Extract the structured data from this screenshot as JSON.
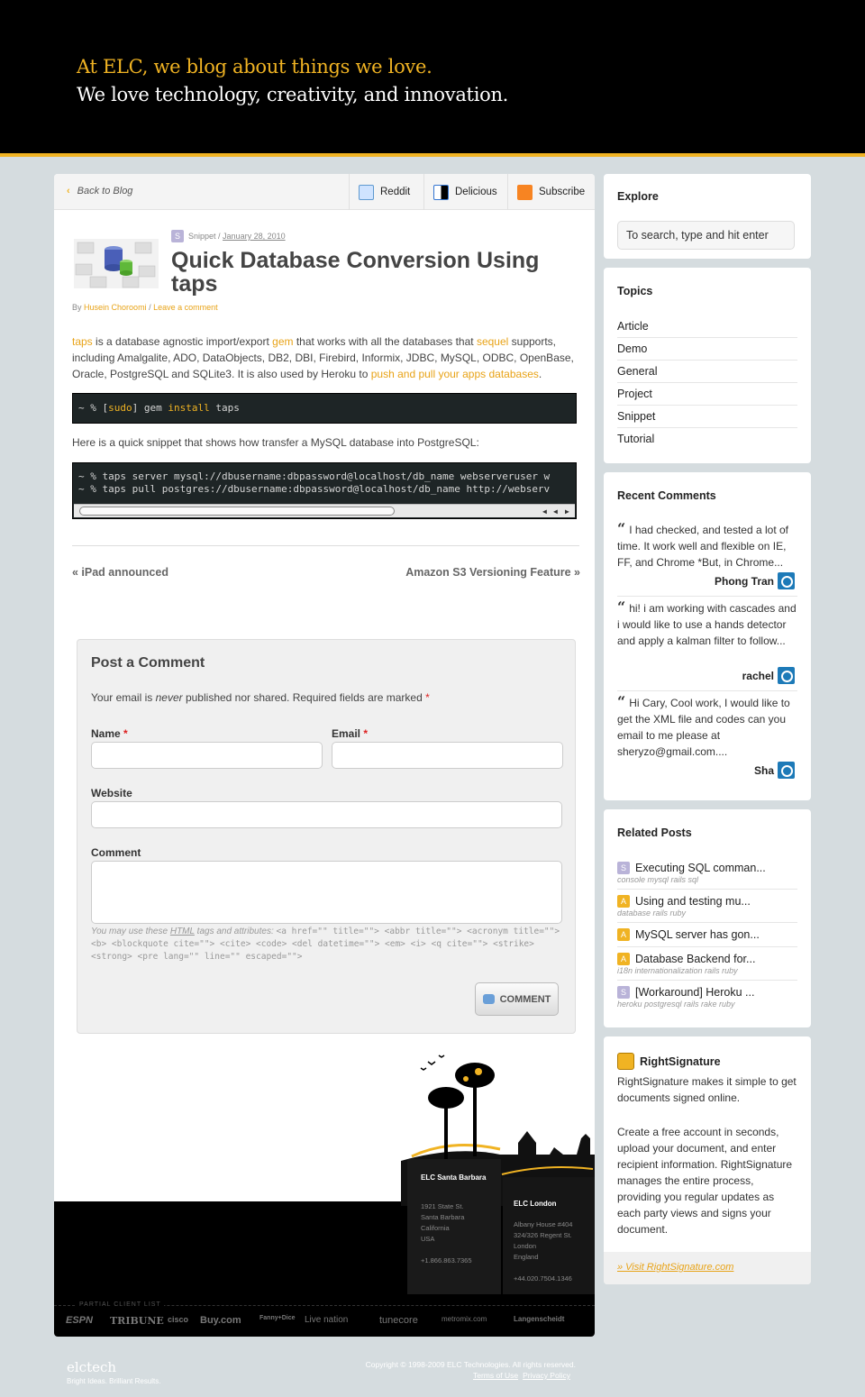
{
  "header": {
    "tagline1": "At ELC, we blog about things we love.",
    "tagline2": "We love technology, creativity, and innovation."
  },
  "topbar": {
    "back_label": "Back to Blog",
    "reddit_label": "Reddit",
    "delicious_label": "Delicious",
    "subscribe_label": "Subscribe"
  },
  "post": {
    "category": "Snippet",
    "date": "January 28, 2010",
    "title": "Quick Database Conversion Using taps",
    "by_prefix": "By",
    "author": "Husein Choroomi",
    "separator": "/",
    "leave_comment": "Leave a comment",
    "para1": {
      "taps": "taps",
      "t1": " is a database agnostic import/export ",
      "gem": "gem",
      "t2": " that works with all the databases that ",
      "sequel": "sequel",
      "t3": " supports, including Amalgalite, ADO, DataObjects, DB2, DBI, Firebird, Informix, JDBC, MySQL, ODBC, OpenBase, Oracle, PostgreSQL and SQLite3. It is also used by Heroku to ",
      "push_link": "push and pull your apps databases",
      "t4": "."
    },
    "code1": {
      "prompt": "~ % ",
      "bracket_open": "[",
      "sudo": "sudo",
      "bracket_close": "]",
      "gem": " gem ",
      "install": "install",
      "rest": " taps"
    },
    "para2": "Here is a quick snippet that shows how transfer a MySQL database into PostgreSQL:",
    "code2": [
      "~ % taps server mysql://dbusername:dbpassword@localhost/db_name webserveruser w",
      "~ % taps pull postgres://dbusername:dbpassword@localhost/db_name http://webserv"
    ],
    "prev": "« iPad announced",
    "next": "Amazon S3 Versioning Feature »"
  },
  "comment_form": {
    "title": "Post a Comment",
    "note_before": "Your email is ",
    "note_never": "never",
    "note_after": " published nor shared. Required fields are marked ",
    "asterisk": "*",
    "name_label": "Name",
    "email_label": "Email",
    "website_label": "Website",
    "comment_label": "Comment",
    "allowed_prefix": "You may use these ",
    "allowed_html": "HTML",
    "allowed_suffix": " tags and attributes: ",
    "allowed_tags": "<a href=\"\" title=\"\"> <abbr title=\"\"> <acronym title=\"\"> <b> <blockquote cite=\"\"> <cite> <code> <del datetime=\"\"> <em> <i> <q cite=\"\"> <strike> <strong> <pre lang=\"\" line=\"\" escaped=\"\">",
    "submit_label": "COMMENT"
  },
  "footer": {
    "sb_city": "ELC Santa Barbara",
    "sb_addr": [
      "1921 State St.",
      "Santa Barbara",
      "California",
      "USA"
    ],
    "sb_phone": "+1.866.863.7365",
    "ld_city": "ELC London",
    "ld_addr": [
      "Albany House #404",
      "324/326 Regent St.",
      "London",
      "England"
    ],
    "ld_phone": "+44.020.7504.1346",
    "client_list_label": "PARTIAL CLIENT LIST",
    "clients": [
      "ESPN",
      "TRIBUNE",
      "cisco",
      "Buy.com",
      "Fanny+Dice",
      "Live nation",
      "tunecore",
      "metromix.com",
      "Langenscheidt"
    ],
    "brand": "elctech",
    "brand_sub": "Bright Ideas. Brilliant Results.",
    "copyright": "Copyright © 1998-2009 ELC Technologies. All rights reserved.",
    "terms": "Terms of Use",
    "privacy": "Privacy Policy"
  },
  "sidebar": {
    "explore_title": "Explore",
    "search_placeholder": "To search, type and hit enter",
    "topics_title": "Topics",
    "topics": [
      "Article",
      "Demo",
      "General",
      "Project",
      "Snippet",
      "Tutorial"
    ],
    "recent_title": "Recent Comments",
    "comments": [
      {
        "text": "I had checked, and tested a lot of time. It work well and flexible on IE, FF, and Chrome *But, in Chrome...",
        "author": "Phong Tran"
      },
      {
        "text": "hi! i am working with cascades and i would like to use a hands detector and apply a kalman filter to follow...",
        "author": "rachel"
      },
      {
        "text": "Hi Cary, Cool work, I would like to get the XML file and codes can you email to me please at sheryzo@gmail.com....",
        "author": "Sha"
      }
    ],
    "related_title": "Related Posts",
    "related": [
      {
        "badge": "S",
        "title": "Executing SQL comman...",
        "tags": "console mysql rails sql"
      },
      {
        "badge": "A",
        "title": "Using and testing mu...",
        "tags": "database rails ruby"
      },
      {
        "badge": "A",
        "title": "MySQL server has gon...",
        "tags": ""
      },
      {
        "badge": "A",
        "title": "Database Backend for...",
        "tags": "i18n internationalization rails ruby"
      },
      {
        "badge": "S",
        "title": "[Workaround] Heroku ...",
        "tags": "heroku postgresql rails rake ruby"
      }
    ],
    "rs_title": "RightSignature",
    "rs_text1": "RightSignature makes it simple to get documents signed online.",
    "rs_text2": "Create a free account in seconds, upload your document, and enter recipient information. RightSignature manages the entire process, providing you regular updates as each party views and signs your document.",
    "rs_link": "» Visit RightSignature.com"
  },
  "colors": {
    "accent": "#f0b323",
    "snippet_badge": "#b9b3d8",
    "article_badge": "#f0b323"
  }
}
